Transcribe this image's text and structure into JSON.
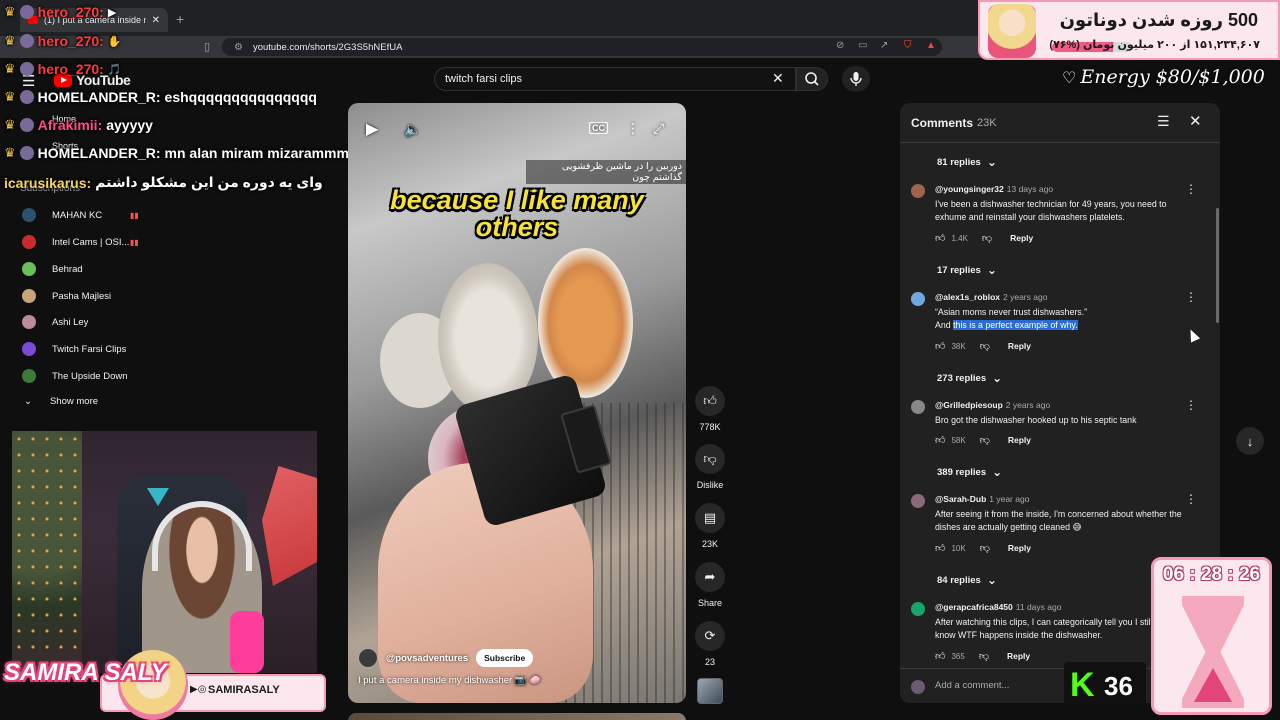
{
  "browser": {
    "tab_title": "(1) I put a camera inside my dishw",
    "url": "youtube.com/shorts/2G3S5hNEfUA"
  },
  "youtube": {
    "logo_text": "YouTube",
    "nav": {
      "home": "Home",
      "shorts": "Shorts",
      "subscriptions": "Subscriptions"
    },
    "subscriptions": [
      {
        "name": "MAHAN KC",
        "live": true,
        "color": "#2f4f6f"
      },
      {
        "name": "Intel Cams | OSI...",
        "live": true,
        "color": "#c82b2b"
      },
      {
        "name": "Behrad",
        "live": false,
        "color": "#6bbf59"
      },
      {
        "name": "Pasha Majlesi",
        "live": false,
        "color": "#c9a37a"
      },
      {
        "name": "Ashi Ley",
        "live": false,
        "color": "#b88c9a"
      },
      {
        "name": "Twitch Farsi Clips",
        "live": false,
        "color": "#7b4ad6"
      },
      {
        "name": "The Upside Down",
        "live": false,
        "color": "#3d7a3a"
      }
    ],
    "show_more": "Show more",
    "search": {
      "value": "twitch farsi clips"
    }
  },
  "chat": [
    {
      "user": "hero_270:",
      "message": "",
      "user_color": "#ff3b3b"
    },
    {
      "user": "hero_270:",
      "message": "",
      "user_color": "#ff3b3b"
    },
    {
      "user": "hero_270:",
      "message": "",
      "user_color": "#ff3b3b"
    },
    {
      "user": "HOMELANDER_R:",
      "message": "eshqqqqqqqqqqqqqqq",
      "user_color": "#ffffff"
    },
    {
      "user": "Afrakimii:",
      "message": "ayyyyy",
      "user_color": "#ff4d8a"
    },
    {
      "user": "HOMELANDER_R:",
      "message": "mn alan miram mizarammm",
      "user_color": "#ffffff"
    },
    {
      "user": "icarusikarus:",
      "message": "وای یه دوره من این مشکلو داشتم",
      "user_color": "#f7d35a"
    }
  ],
  "video": {
    "caption_fa": "دوربین را در ماشین ظرفشویی گذاشتم چون",
    "caption_en": "because I like many others",
    "channel": "@povsadventures",
    "subscribe_label": "Subscribe",
    "title": "I put a camera inside my dishwasher 📷 🧼"
  },
  "actions": {
    "likes": "778K",
    "dislike": "Dislike",
    "comments": "23K",
    "share": "Share",
    "remix": "23"
  },
  "comments_panel": {
    "title": "Comments",
    "count": "23K",
    "add_placeholder": "Add a comment...",
    "items": [
      {
        "replies_above": "81 replies",
        "author": "@youngsinger32",
        "time": "13 days ago",
        "body_lines": [
          "I've been a dishwasher technician for 49 years, you need to",
          "exhume and reinstall your dishwashers platelets."
        ],
        "likes": "1.4K",
        "reply": "Reply",
        "color": "#a0644e"
      },
      {
        "replies_above": "17 replies",
        "author": "@alex1s_roblox",
        "time": "2 years ago",
        "body_lines": [
          "“Asian moms never trust dishwashers.”"
        ],
        "body_pre": "And ",
        "body_hl": "this is a perfect example of why.",
        "likes": "38K",
        "reply": "Reply",
        "color": "#6fa8dc"
      },
      {
        "replies_above": "273 replies",
        "author": "@Grilledpiesoup",
        "time": "2 years ago",
        "body_lines": [
          "Bro got the dishwasher hooked up to his septic tank"
        ],
        "likes": "58K",
        "reply": "Reply",
        "color": "#888888"
      },
      {
        "replies_above": "389 replies",
        "author": "@Sarah-Dub",
        "time": "1 year ago",
        "body_lines": [
          "After seeing it from the inside, I'm concerned about whether the",
          "dishes are actually getting cleaned 😅"
        ],
        "likes": "10K",
        "reply": "Reply",
        "color": "#8a6a7a"
      },
      {
        "replies_above": "84 replies",
        "author": "@gerapcafrica8450",
        "time": "11 days ago",
        "body_lines": [
          "After watching this clips, I can categorically tell you I still don't",
          "know WTF happens inside the dishwasher."
        ],
        "likes": "365",
        "reply": "Reply",
        "color": "#1aa36b"
      }
    ]
  },
  "overlays": {
    "donate_title": "500 روزه شدن دوناتون",
    "donate_sub": "۱۵۱,۲۳۴,۶۰۷ از ۲۰۰ میلیون تومان (%۷۶)",
    "donate_progress": 0.76,
    "energy": "Energy $80/$1,000",
    "streamer_name": "SAMIRA SALY",
    "social_handle": "SAMIRASALY",
    "viewer_count": "36",
    "timer": "06 : 28 : 26"
  }
}
